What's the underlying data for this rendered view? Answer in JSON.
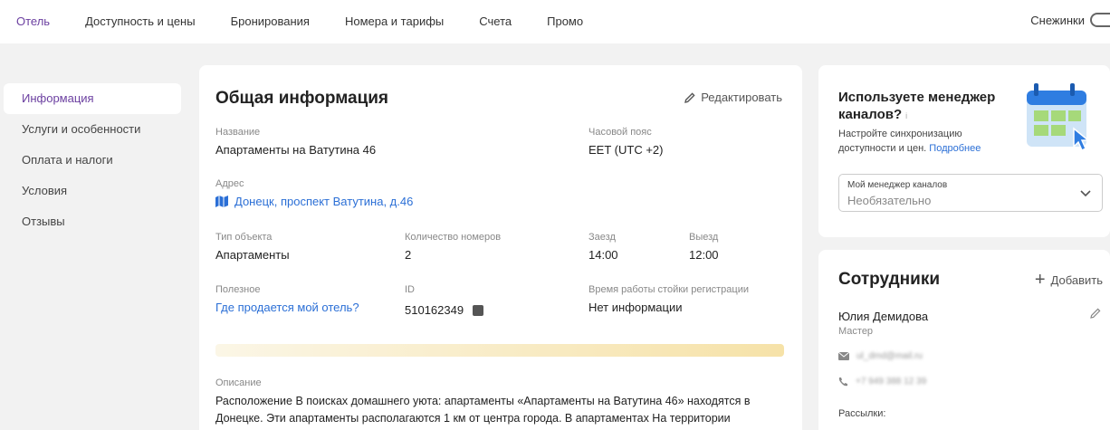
{
  "topnav": {
    "items": [
      "Отель",
      "Доступность и цены",
      "Бронирования",
      "Номера и тарифы",
      "Счета",
      "Промо"
    ],
    "snow_label": "Снежинки"
  },
  "sidebar": {
    "items": [
      "Информация",
      "Услуги и особенности",
      "Оплата и налоги",
      "Условия",
      "Отзывы"
    ]
  },
  "main": {
    "title": "Общая информация",
    "edit_label": "Редактировать",
    "name_label": "Название",
    "name_value": "Апартаменты на Ватутина 46",
    "tz_label": "Часовой пояс",
    "tz_value": "EET (UTC +2)",
    "address_label": "Адрес",
    "address_value": "Донецк, проспект Ватутина, д.46",
    "type_label": "Тип объекта",
    "type_value": "Апартаменты",
    "rooms_label": "Количество номеров",
    "rooms_value": "2",
    "checkin_label": "Заезд",
    "checkin_value": "14:00",
    "checkout_label": "Выезд",
    "checkout_value": "12:00",
    "useful_label": "Полезное",
    "useful_link": "Где продается мой отель?",
    "id_label": "ID",
    "id_value": "510162349",
    "desk_label": "Время работы стойки регистрации",
    "desk_value": "Нет информации",
    "desc_label": "Описание",
    "desc_text": "Расположение В поисках домашнего уюта: апартаменты «Апартаменты на Ватутина 46» находятся в Донецке. Эти апартаменты располагаются 1 км от центра города. В апартаментах На территории"
  },
  "channel_manager": {
    "title": "Используете менеджер каналов?",
    "info": "i",
    "subtitle": "Настройте синхронизацию доступности и цен.",
    "more_link": "Подробнее",
    "select_label": "Мой менеджер каналов",
    "select_value": "Необязательно"
  },
  "staff": {
    "title": "Сотрудники",
    "add_label": "Добавить",
    "person_name": "Юлия Демидова",
    "person_role": "Мастер",
    "email": "ul_dmd@mail.ru",
    "phone": "+7 949 388 12 39",
    "subscriptions_label": "Рассылки:"
  },
  "colors": {
    "accent": "#6b3fa0",
    "link": "#2b6fd6"
  }
}
